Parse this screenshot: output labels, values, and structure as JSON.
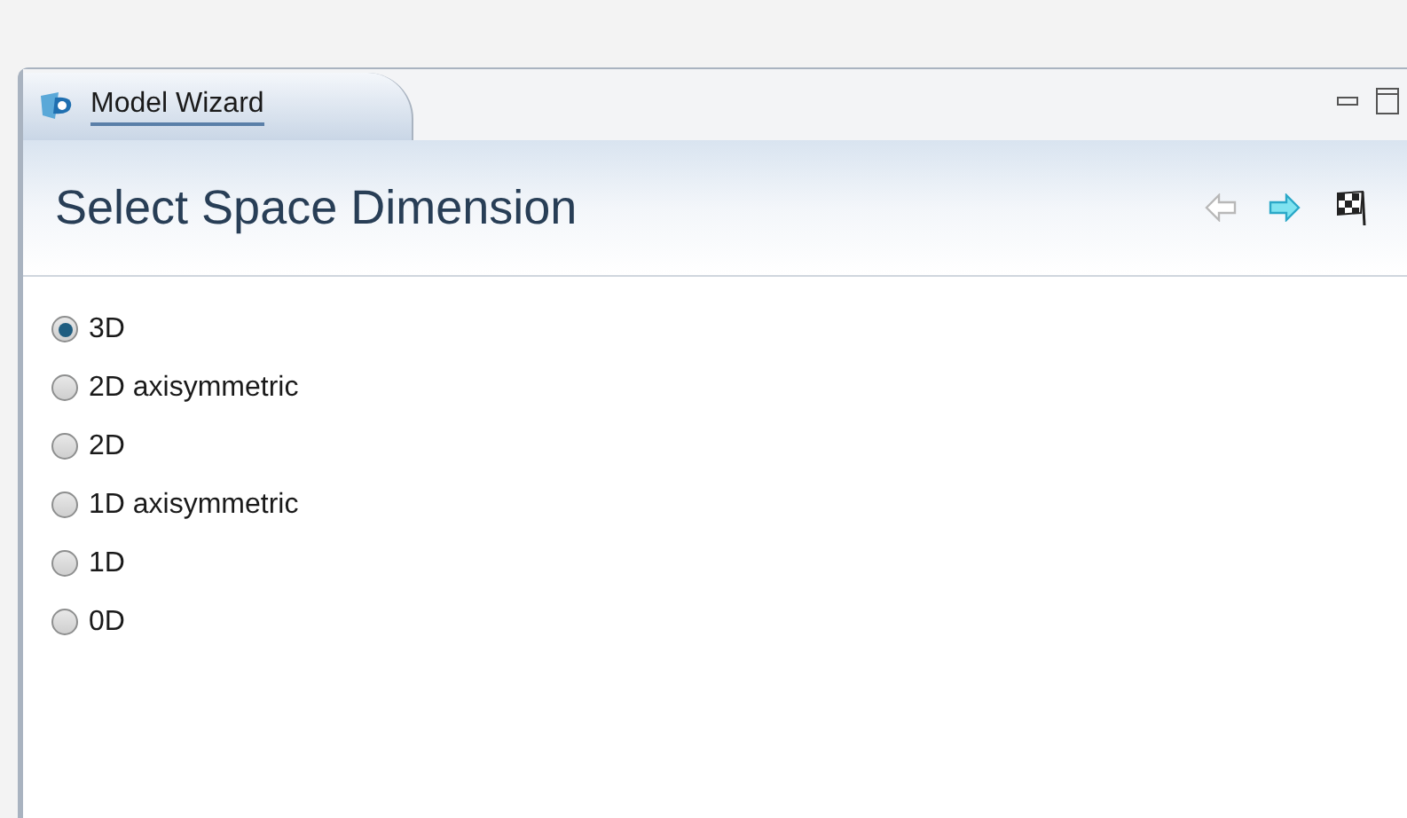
{
  "tab": {
    "label": "Model Wizard",
    "selected": true
  },
  "header": {
    "title": "Select Space Dimension"
  },
  "nav": {
    "back_disabled": true,
    "next_disabled": false
  },
  "options": [
    {
      "label": "3D",
      "selected": true
    },
    {
      "label": "2D axisymmetric",
      "selected": false
    },
    {
      "label": "2D",
      "selected": false
    },
    {
      "label": "1D axisymmetric",
      "selected": false
    },
    {
      "label": "1D",
      "selected": false
    },
    {
      "label": "0D",
      "selected": false
    }
  ]
}
